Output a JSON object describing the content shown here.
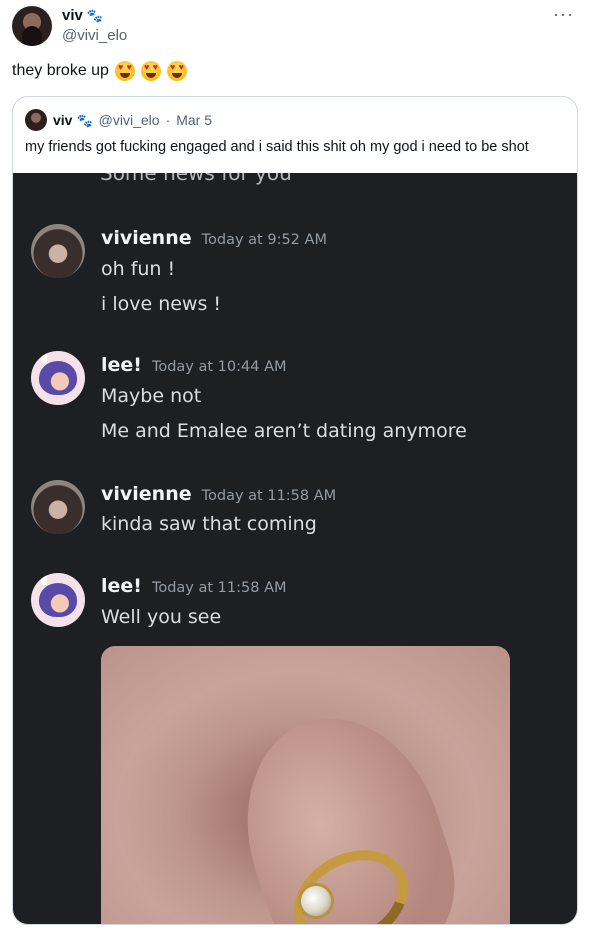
{
  "tweet": {
    "display_name": "viv",
    "name_decoration_icon": "paw-prints-icon",
    "handle": "@vivi_elo",
    "more_label": "···",
    "text": "they broke up",
    "emojis": [
      "heart-eyes-emoji",
      "heart-eyes-emoji",
      "heart-eyes-emoji"
    ]
  },
  "quote": {
    "display_name": "viv",
    "handle": "@vivi_elo",
    "separator": "·",
    "date": "Mar 5",
    "text": "my friends got fucking engaged and i said this shit oh my god i need to be shot"
  },
  "discord": {
    "cut_off_text": "Some news for you",
    "messages": [
      {
        "user": "vivienne",
        "time": "Today at 9:52 AM",
        "lines": [
          "oh fun !",
          "i love news !"
        ]
      },
      {
        "user": "lee!",
        "time": "Today at 10:44 AM",
        "lines": [
          "Maybe not",
          "Me and Emalee aren’t dating anymore"
        ]
      },
      {
        "user": "vivienne",
        "time": "Today at 11:58 AM",
        "lines": [
          "kinda saw that coming"
        ]
      },
      {
        "user": "lee!",
        "time": "Today at 11:58 AM",
        "lines": [
          "Well you see"
        ]
      }
    ]
  },
  "colors": {
    "discord_bg": "#1e1f22",
    "discord_username": "#f2f3f5",
    "discord_text": "#dbdee1",
    "discord_timestamp": "#949ba4",
    "twitter_secondary": "#536471"
  }
}
